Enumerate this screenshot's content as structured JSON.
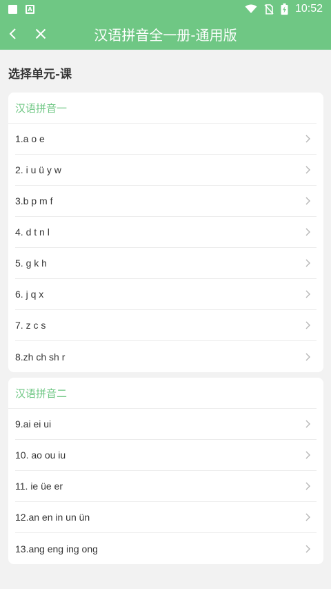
{
  "status_bar": {
    "time": "10:52"
  },
  "header": {
    "title": "汉语拼音全一册-通用版"
  },
  "section_title": "选择单元-课",
  "units": [
    {
      "name": "汉语拼音一",
      "lessons": [
        "1.a o e",
        "2. i u ü y w",
        "3.b p m f",
        "4. d t n l",
        "5. g k h",
        "6. j q x",
        "7. z c s",
        "8.zh ch sh r"
      ]
    },
    {
      "name": "汉语拼音二",
      "lessons": [
        "9.ai ei ui",
        "10. ao ou iu",
        "11. ie üe er",
        "12.an en in un ün",
        "13.ang eng ing ong"
      ]
    }
  ],
  "colors": {
    "accent": "#6fc784",
    "background": "#f2f2f2",
    "text": "#333333"
  }
}
